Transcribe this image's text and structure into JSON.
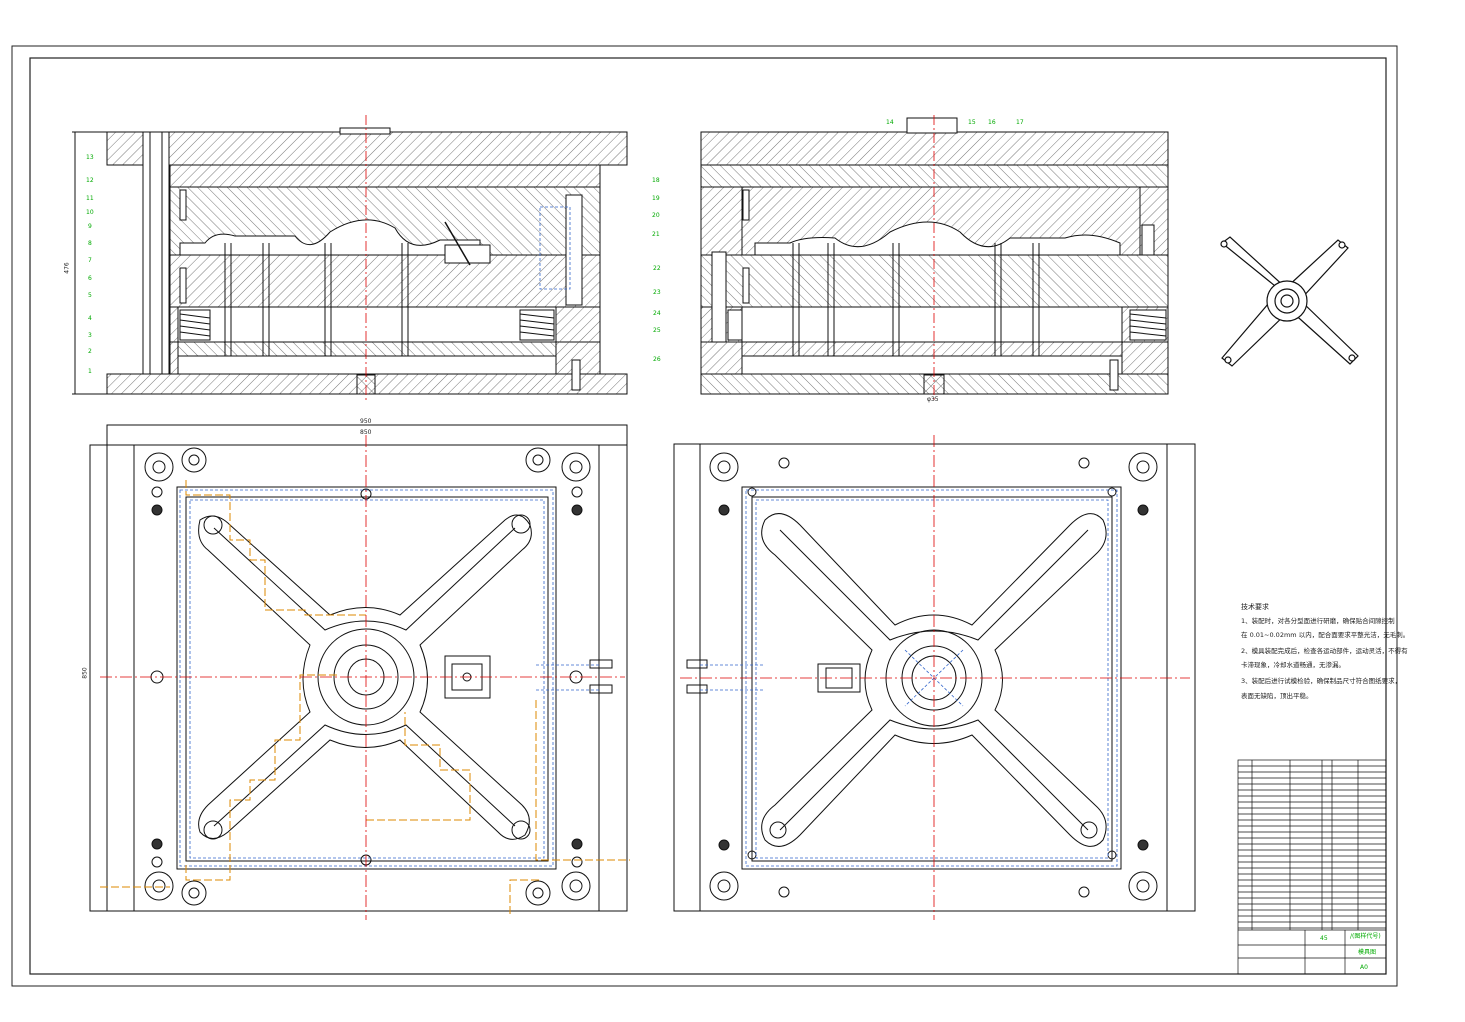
{
  "left_section_labels": [
    "1",
    "2",
    "3",
    "4",
    "5",
    "6",
    "7",
    "8",
    "9",
    "10",
    "11",
    "12",
    "13"
  ],
  "left_right_labels": [
    "18",
    "19",
    "20",
    "21"
  ],
  "right_section_labels_top": [
    "14",
    "15",
    "16",
    "17"
  ],
  "right_section_labels_left": [
    "22",
    "23",
    "24",
    "25",
    "26"
  ],
  "dims": {
    "top_width_outer": "950",
    "top_width_inner": "850",
    "left_height": "850",
    "section_height": "476",
    "sprue_dia": "φ35"
  },
  "tech_title": "技术要求",
  "tech_lines": [
    "1、装配时，对各分型面进行研磨，确保贴合间隙控制",
    "在 0.01~0.02mm 以内，配合面要求平整光洁，无毛刺。",
    "2、模具装配完成后，检查各运动部件，运动灵活，不得有",
    "卡滞现象，冷却水道畅通，无渗漏。",
    "3、装配后进行试模检验，确保制品尺寸符合图纸要求，",
    "表面无缺陷，顶出平稳。"
  ],
  "title_block": {
    "material": "45",
    "drawing_no": "/(图样代号)",
    "name": "模具图",
    "scale": "A0"
  },
  "colors": {
    "line": "#111111",
    "hatch": "#555555",
    "center": "#dd0000",
    "hidden": "#3366cc",
    "orange": "#dd8800",
    "label": "#00aa00"
  }
}
